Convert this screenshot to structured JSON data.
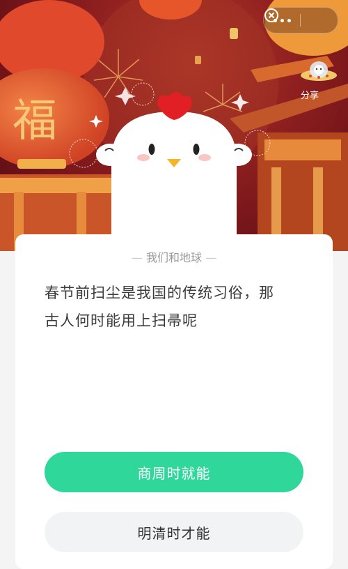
{
  "header": {
    "more_icon": "more-dots-icon",
    "close_icon": "close-circle-icon",
    "share_label": "分享",
    "lantern_char": "福"
  },
  "card": {
    "title": "我们和地球",
    "question_line1": "春节前扫尘是我国的传统习俗，那",
    "question_line2": "古人何时能用上扫帚呢",
    "options": [
      {
        "label": "商周时就能"
      },
      {
        "label": "明清时才能"
      }
    ]
  },
  "colors": {
    "accent": "#2fd79a",
    "option_bg": "#f2f3f5",
    "hero_red": "#8e1f1f"
  }
}
